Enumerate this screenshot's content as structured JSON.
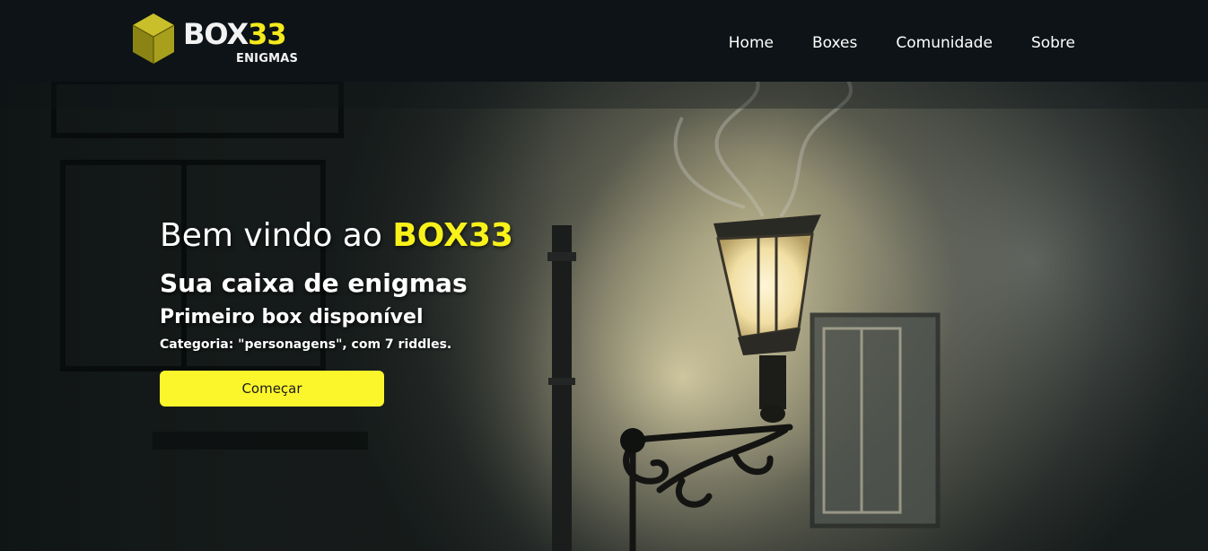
{
  "brand": {
    "word_main": "BOX",
    "word_number": "33",
    "subtitle": "ENIGMAS",
    "logo_icon": "yellow-cube-icon"
  },
  "nav": {
    "items": [
      {
        "label": "Home"
      },
      {
        "label": "Boxes"
      },
      {
        "label": "Comunidade"
      },
      {
        "label": "Sobre"
      }
    ]
  },
  "hero": {
    "title_prefix": "Bem vindo ao ",
    "title_brand": "BOX33",
    "subtitle": "Sua caixa de enigmas",
    "announcement": "Primeiro box disponível",
    "category": "Categoria: \"personagens\", com 7 riddles.",
    "cta_label": "Começar",
    "background_image": "street-lamp-night-photo"
  },
  "colors": {
    "navbar_bg": "#0d1316",
    "accent_yellow": "#f8f21a",
    "button_yellow": "#fbf62c",
    "text": "#ffffff"
  }
}
